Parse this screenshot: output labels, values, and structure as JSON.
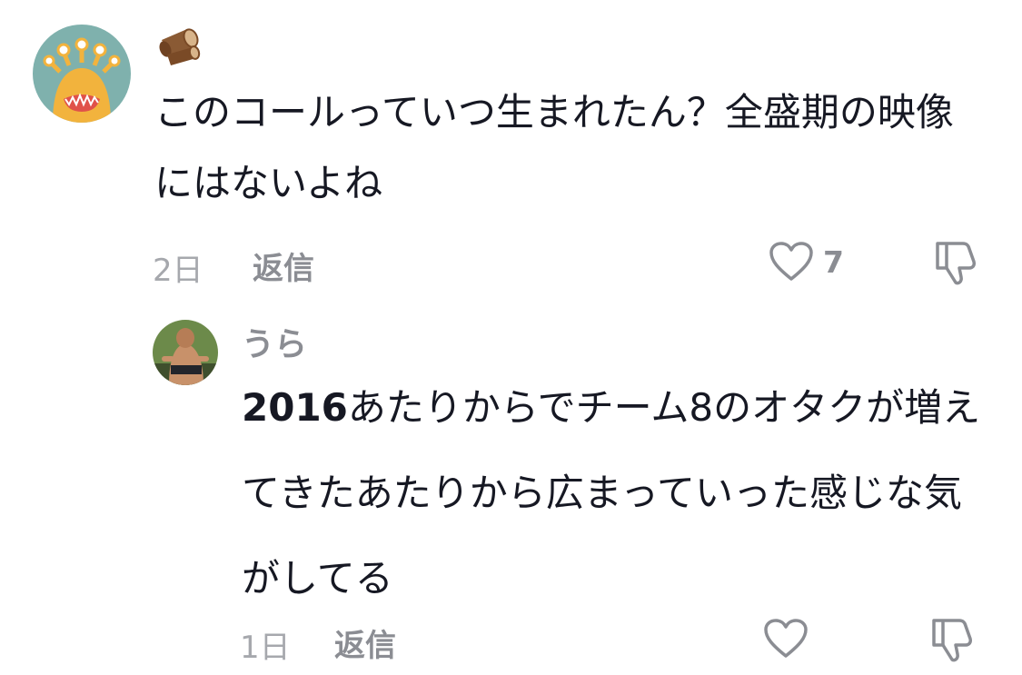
{
  "comments": [
    {
      "avatar": "monster-avatar-icon",
      "username_badge": "log-emoji-icon",
      "text": "このコールっていつ生まれたん？全盛期の映像にはないよね",
      "time": "2日",
      "reply_label": "返信",
      "likes": "7"
    },
    {
      "avatar": "photo-avatar",
      "username": "うら",
      "text_lead": "2016",
      "text_rest": "あたりからでチーム8のオタクが増えてきたあたりから広まっていった感じな気がしてる",
      "time": "1日",
      "reply_label": "返信"
    }
  ],
  "colors": {
    "text": "#161823",
    "muted": "#8b8d93",
    "time": "#a6a8ad",
    "avatar_bg": "#7fb1ad",
    "avatar_monster": "#f2b33d"
  }
}
